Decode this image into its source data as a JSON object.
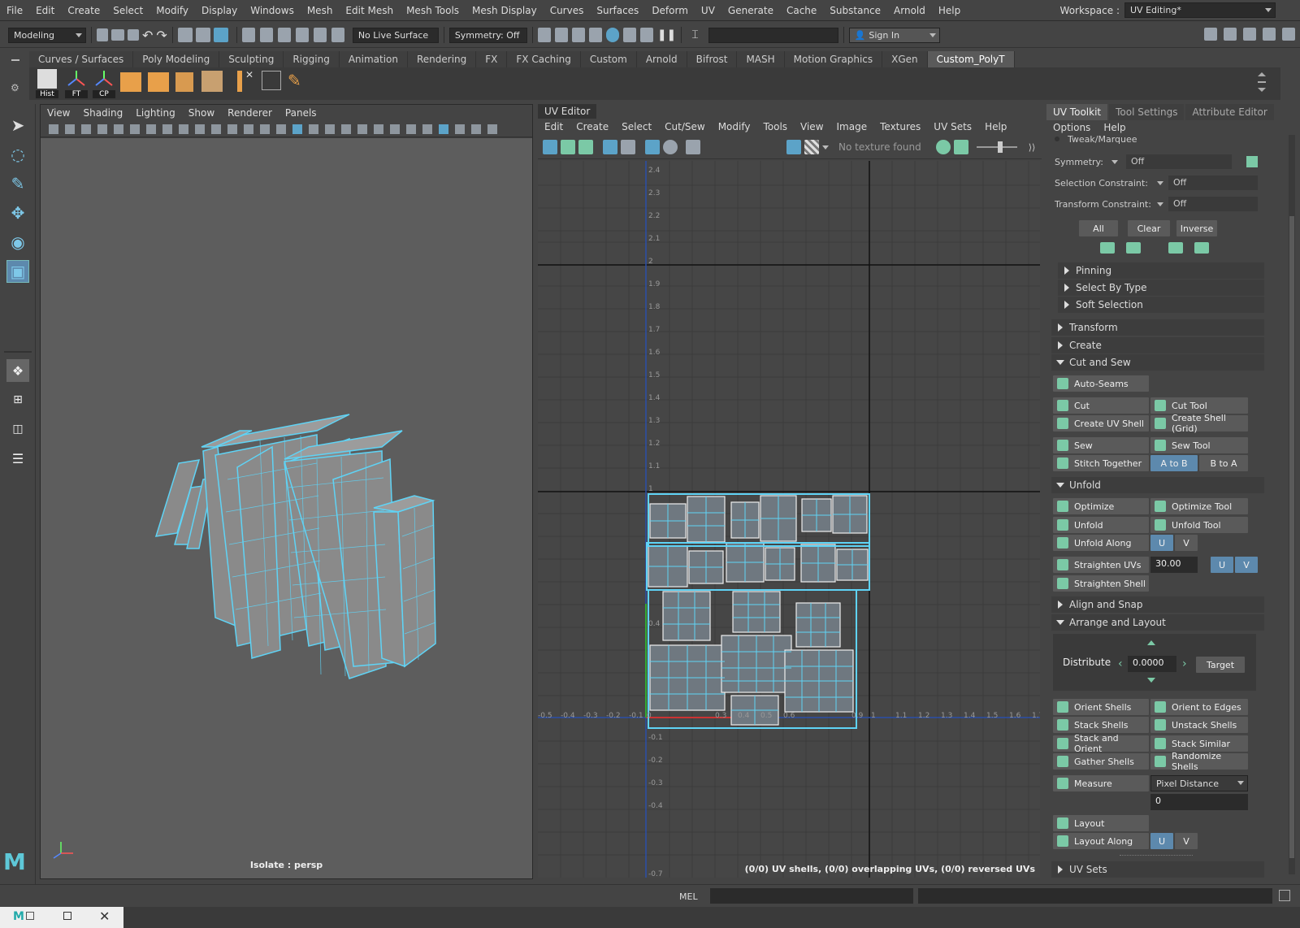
{
  "menubar": {
    "items": [
      "File",
      "Edit",
      "Create",
      "Select",
      "Modify",
      "Display",
      "Windows",
      "Mesh",
      "Edit Mesh",
      "Mesh Tools",
      "Mesh Display",
      "Curves",
      "Surfaces",
      "Deform",
      "UV",
      "Generate",
      "Cache",
      "Substance",
      "Arnold",
      "Help"
    ],
    "workspace_label": "Workspace :",
    "workspace_value": "UV Editing*"
  },
  "statusline": {
    "mode": "Modeling",
    "live_surface": "No Live Surface",
    "symmetry": "Symmetry: Off",
    "sign_in": "Sign In"
  },
  "shelf": {
    "tabs": [
      "Curves / Surfaces",
      "Poly Modeling",
      "Sculpting",
      "Rigging",
      "Animation",
      "Rendering",
      "FX",
      "FX Caching",
      "Custom",
      "Arnold",
      "Bifrost",
      "MASH",
      "Motion Graphics",
      "XGen",
      "Custom_PolyT"
    ],
    "active_tab": "Custom_PolyT",
    "icon_labels": [
      "Hist",
      "FT",
      "CP"
    ]
  },
  "viewport": {
    "menu": [
      "View",
      "Shading",
      "Lighting",
      "Show",
      "Renderer",
      "Panels"
    ],
    "isolate_label": "Isolate : persp",
    "wire_color": "#5fd3f5"
  },
  "uv_editor": {
    "title": "UV Editor",
    "menu": [
      "Edit",
      "Create",
      "Select",
      "Cut/Sew",
      "Modify",
      "Tools",
      "View",
      "Image",
      "Textures",
      "UV Sets",
      "Help"
    ],
    "no_texture": "No texture found",
    "info": "(0/0) UV shells, (0/0) overlapping UVs, (0/0) reversed UVs",
    "v_ticks": [
      "2.4",
      "2.3",
      "2.2",
      "2.1",
      "2",
      "1.9",
      "1.8",
      "1.7",
      "1.6",
      "1.5",
      "1.4",
      "1.3",
      "1.2",
      "1.1",
      "1",
      "0.4",
      "-0.1",
      "-0.2",
      "-0.3",
      "-0.4",
      "-0.7"
    ],
    "u_ticks": [
      "-0.5",
      "-0.4",
      "-0.3",
      "-0.2",
      "-0.1",
      "0",
      "0.3",
      "0.4",
      "0.5",
      "0.6",
      "0.9",
      "1",
      "1.1",
      "1.2",
      "1.3",
      "1.4",
      "1.5",
      "1.6",
      "1.7"
    ]
  },
  "uv_toolkit": {
    "tabs": [
      "UV Toolkit",
      "Tool Settings",
      "Attribute Editor"
    ],
    "menu": [
      "Options",
      "Help"
    ],
    "tweak": "Tweak/Marquee",
    "symmetry_label": "Symmetry:",
    "symmetry_value": "Off",
    "selection_constraint_label": "Selection Constraint:",
    "selection_constraint_value": "Off",
    "transform_constraint_label": "Transform Constraint:",
    "transform_constraint_value": "Off",
    "sel_buttons": [
      "All",
      "Clear",
      "Inverse"
    ],
    "subsections": [
      "Pinning",
      "Select By Type",
      "Soft Selection"
    ],
    "sections": {
      "transform": "Transform",
      "create": "Create",
      "cut_and_sew": "Cut and Sew",
      "unfold": "Unfold",
      "align_and_snap": "Align and Snap",
      "arrange_and_layout": "Arrange and Layout",
      "uv_sets": "UV Sets"
    },
    "cut_sew": {
      "auto_seams": "Auto-Seams",
      "cut": "Cut",
      "cut_tool": "Cut Tool",
      "create_uv_shell": "Create UV Shell",
      "create_shell_grid": "Create Shell (Grid)",
      "sew": "Sew",
      "sew_tool": "Sew Tool",
      "stitch_together": "Stitch Together",
      "a_to_b": "A to B",
      "b_to_a": "B to A"
    },
    "unfold": {
      "optimize": "Optimize",
      "optimize_tool": "Optimize Tool",
      "unfold": "Unfold",
      "unfold_tool": "Unfold Tool",
      "unfold_along": "Unfold Along",
      "u": "U",
      "v": "V",
      "straighten_uvs": "Straighten UVs",
      "straighten_value": "30.00",
      "straighten_shell": "Straighten Shell"
    },
    "arrange": {
      "distribute": "Distribute",
      "distribute_value": "0.0000",
      "target": "Target",
      "orient_shells": "Orient Shells",
      "orient_to_edges": "Orient to Edges",
      "stack_shells": "Stack Shells",
      "unstack_shells": "Unstack Shells",
      "stack_and_orient": "Stack and Orient",
      "stack_similar": "Stack Similar",
      "gather_shells": "Gather Shells",
      "randomize_shells": "Randomize Shells",
      "measure": "Measure",
      "measure_mode": "Pixel Distance",
      "measure_value": "0",
      "layout": "Layout",
      "layout_along": "Layout Along"
    }
  },
  "bottom": {
    "mel": "MEL"
  }
}
